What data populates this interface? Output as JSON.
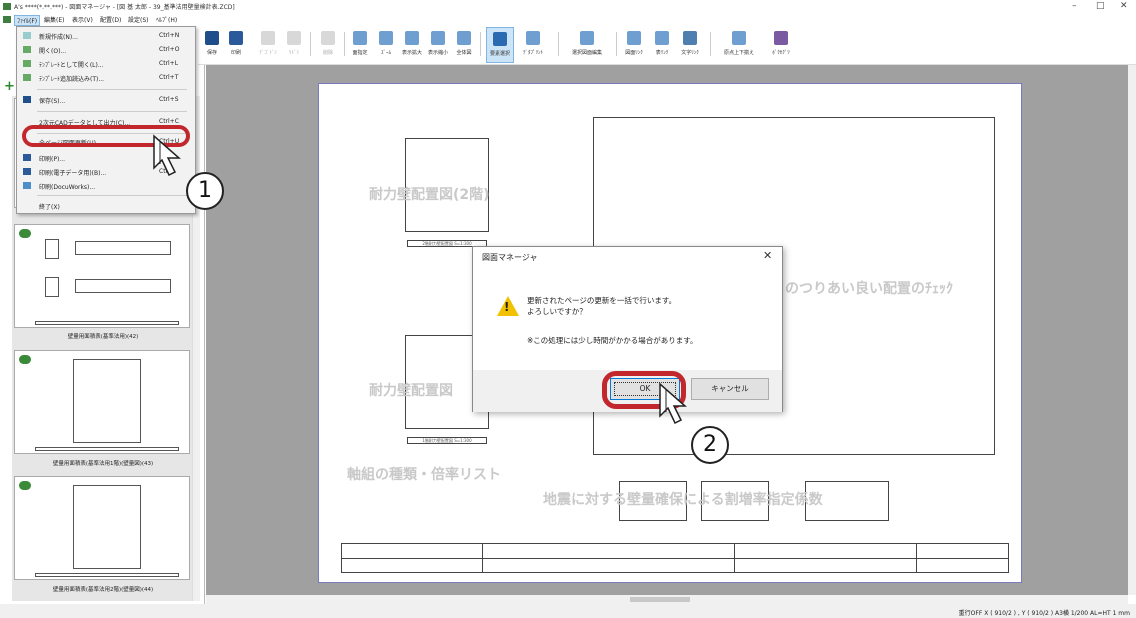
{
  "window": {
    "title": "A's ****(*.**.***) - 図面マネージャ - [図 基  太郎 - 39_基準法用壁量検計表.ZCD]",
    "min": "–",
    "max": "□",
    "close": "✕"
  },
  "menubar": {
    "items": [
      "ﾌｧｲﾙ(F)",
      "編集(E)",
      "表示(V)",
      "配置(D)",
      "設定(S)",
      "ﾍﾙﾌﾟ(H)"
    ]
  },
  "toolbar": {
    "buttons": [
      "保存",
      "印刷",
      "ﾃﾞｺﾞﾄﾞｼ",
      "ﾘﾄﾞｼ",
      "削除",
      "面指定",
      "ｽﾞｰﾑ",
      "表示拡大",
      "表示縮小",
      "全体図",
      "要素選択",
      "ﾃﾞﾀﾌﾟﾘﾝﾄ",
      "選択図面編集",
      "図面ﾘﾝｸ",
      "表ﾘﾝｸ",
      "文字ﾘﾝｸ",
      "原点上下揃え",
      "ﾎﾞｸｾｸﾞﾂ"
    ]
  },
  "file_menu": {
    "items": [
      {
        "label": "新規作成(N)...",
        "shortcut": "Ctrl+N"
      },
      {
        "label": "開く(O)...",
        "shortcut": "Ctrl+O"
      },
      {
        "label": "ﾃﾝﾌﾟﾚｰﾄとして開く(L)...",
        "shortcut": "Ctrl+L"
      },
      {
        "label": "ﾃﾝﾌﾟﾚｰﾄ追加読込み(T)...",
        "shortcut": "Ctrl+T"
      },
      {
        "label": "保存(S)...",
        "shortcut": "Ctrl+S"
      },
      {
        "label": "2次元CADデータとして出力(C)...",
        "shortcut": "Ctrl+C"
      },
      {
        "label": "全ページ図面更新(U)...",
        "shortcut": "Ctrl+U"
      },
      {
        "label": "印刷(P)...",
        "shortcut": ""
      },
      {
        "label": "印刷(電子データ用)(B)...",
        "shortcut": "Ctrl"
      },
      {
        "label": "印刷(DocuWorks)...",
        "shortcut": ""
      },
      {
        "label": "終了(X)",
        "shortcut": ""
      }
    ]
  },
  "thumbnails": {
    "labels": [
      "壁量用面積表(基準法用)(42)",
      "壁量用面積表(基準法用1階)(壁量図)(43)",
      "壁量用面積表(基準法用2階)(壁量図)(44)"
    ]
  },
  "drawing": {
    "texts": [
      "耐力壁配置図(2階)",
      "耐力壁配置図",
      "軸組の種類・倍率リスト",
      "地震に対する壁量確保による割増率指定係数",
      "のつりあい良い配置のﾁｪｯｸ"
    ],
    "captions": [
      "2階耐力壁配置図 S=1:300",
      "1階耐力壁配置図 S=1:300"
    ]
  },
  "dialog": {
    "title": "図面マネージャ",
    "close": "✕",
    "line1": "更新されたページの更新を一括で行います。",
    "line2": "よろしいですか？",
    "note": "※この処理には少し時間がかかる場合があります。",
    "ok": "OK",
    "cancel": "キャンセル",
    "warn": "!"
  },
  "callouts": [
    "1",
    "2"
  ],
  "statusbar": {
    "text": "重行OFF   X ( 910/2 ) , Y ( 910/2 )   A3横   1/200   AL=HT 1   mm"
  },
  "colors": {
    "highlight": "#c1272d",
    "accent": "#0078d7",
    "canvas": "#a0a0a0"
  }
}
